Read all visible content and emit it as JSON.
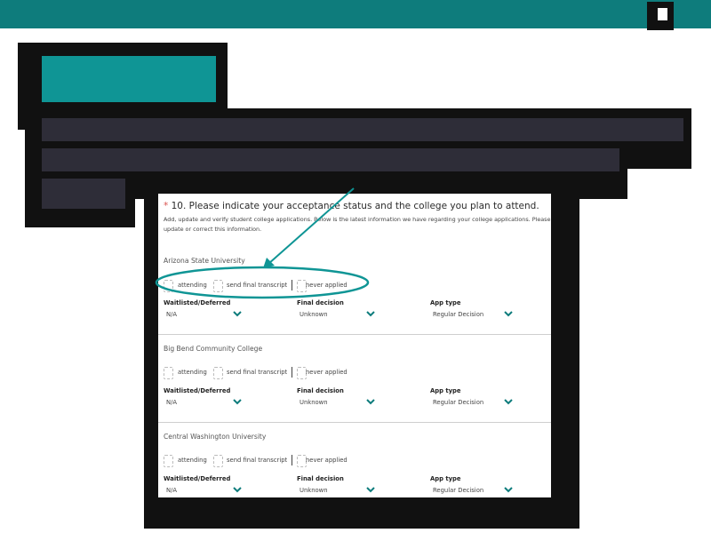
{
  "question": {
    "required_mark": "*",
    "text": "10. Please indicate your acceptance status and the college you plan to attend.",
    "help": "Add, update and verify student college applications. Below is the latest information we have regarding your college applications. Please update or correct this information."
  },
  "options": {
    "attending": "attending",
    "send_transcript": "send final transcript",
    "never_applied": "never applied"
  },
  "field_labels": {
    "waitlisted": "Waitlisted/Deferred",
    "final_decision": "Final decision",
    "app_type": "App type"
  },
  "colleges": [
    {
      "name": "Arizona State University",
      "waitlisted": "N/A",
      "final_decision": "Unknown",
      "app_type": "Regular Decision"
    },
    {
      "name": "Big Bend Community College",
      "waitlisted": "N/A",
      "final_decision": "Unknown",
      "app_type": "Regular Decision"
    },
    {
      "name": "Central Washington University",
      "waitlisted": "N/A",
      "final_decision": "Unknown",
      "app_type": "Regular Decision"
    }
  ],
  "colors": {
    "accent": "#0e7c7c",
    "highlight": "#0f9595",
    "required": "#d9534f"
  },
  "icons": [
    "chevron-down-icon",
    "annotation-arrow",
    "annotation-ellipse"
  ]
}
